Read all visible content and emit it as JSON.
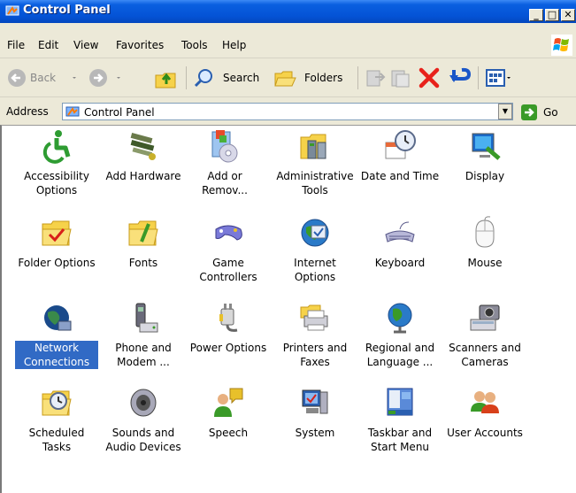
{
  "window": {
    "title": "Control Panel"
  },
  "title_buttons": {
    "min": "_",
    "max": "□",
    "close": "✕"
  },
  "menu": [
    "File",
    "Edit",
    "View",
    "Favorites",
    "Tools",
    "Help"
  ],
  "toolbar": {
    "back_label": "Back",
    "search_label": "Search",
    "folders_label": "Folders"
  },
  "address": {
    "label": "Address",
    "value": "Control Panel",
    "go_label": "Go"
  },
  "items": [
    {
      "label": "Accessibility Options",
      "icon": "accessibility-icon"
    },
    {
      "label": "Add Hardware",
      "icon": "add-hardware-icon"
    },
    {
      "label": "Add or Remov...",
      "icon": "add-remove-programs-icon"
    },
    {
      "label": "Administrative Tools",
      "icon": "administrative-tools-icon"
    },
    {
      "label": "Date and Time",
      "icon": "date-time-icon"
    },
    {
      "label": "Display",
      "icon": "display-icon"
    },
    {
      "label": "Folder Options",
      "icon": "folder-options-icon"
    },
    {
      "label": "Fonts",
      "icon": "fonts-folder-icon"
    },
    {
      "label": "Game Controllers",
      "icon": "game-controller-icon"
    },
    {
      "label": "Internet Options",
      "icon": "internet-options-icon"
    },
    {
      "label": "Keyboard",
      "icon": "keyboard-icon"
    },
    {
      "label": "Mouse",
      "icon": "mouse-icon"
    },
    {
      "label": "Network Connections",
      "icon": "network-globe-icon"
    },
    {
      "label": "Phone and Modem ...",
      "icon": "phone-modem-icon"
    },
    {
      "label": "Power Options",
      "icon": "power-plug-icon"
    },
    {
      "label": "Printers and Faxes",
      "icon": "printer-icon"
    },
    {
      "label": "Regional and Language ...",
      "icon": "globe-icon"
    },
    {
      "label": "Scanners and Cameras",
      "icon": "scanner-camera-icon"
    },
    {
      "label": "Scheduled Tasks",
      "icon": "scheduled-tasks-icon"
    },
    {
      "label": "Sounds and Audio Devices",
      "icon": "speaker-icon"
    },
    {
      "label": "Speech",
      "icon": "speech-icon"
    },
    {
      "label": "System",
      "icon": "system-icon"
    },
    {
      "label": "Taskbar and Start Menu",
      "icon": "taskbar-icon"
    },
    {
      "label": "User Accounts",
      "icon": "user-accounts-icon"
    }
  ],
  "selected_item": "Network Connections",
  "colors": {
    "titlebar": "#0453d6",
    "selection": "#316AC5",
    "chrome": "#ECE9D8"
  }
}
